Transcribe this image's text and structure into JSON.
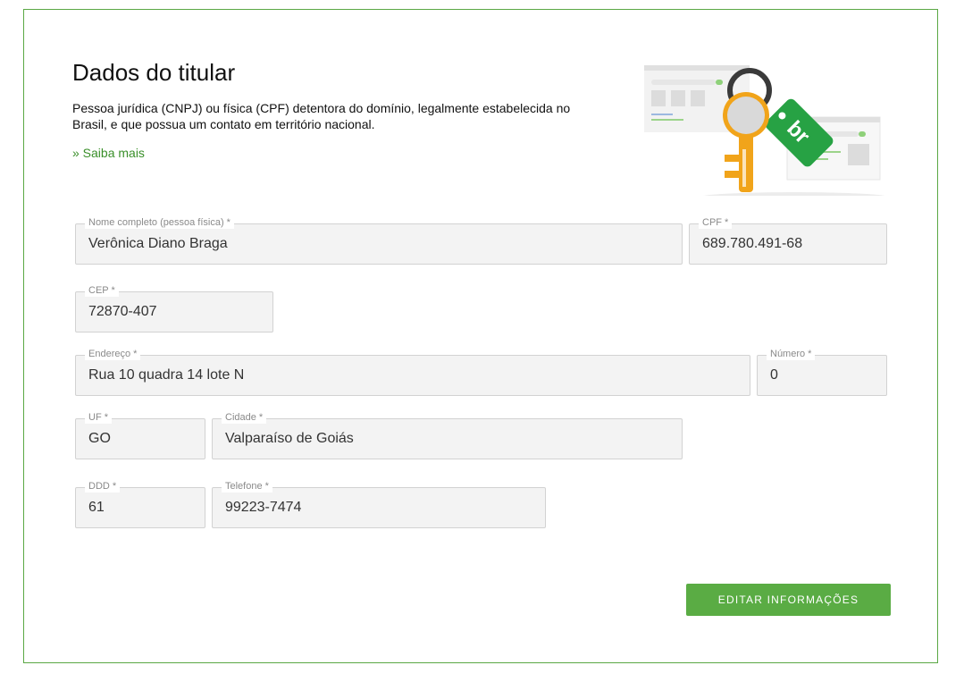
{
  "header": {
    "title": "Dados do titular",
    "description": "Pessoa jurídica (CNPJ) ou física (CPF) detentora do domínio, legalmente estabelecida no Brasil, e que possua um contato em território nacional.",
    "link": "» Saiba mais",
    "illustration_tag": "br"
  },
  "form": {
    "nome": {
      "label": "Nome completo (pessoa física) *",
      "value": "Verônica Diano Braga"
    },
    "cpf": {
      "label": "CPF *",
      "value": "689.780.491-68"
    },
    "cep": {
      "label": "CEP *",
      "value": "72870-407"
    },
    "endereco": {
      "label": "Endereço *",
      "value": "Rua 10 quadra 14 lote N"
    },
    "numero": {
      "label": "Número *",
      "value": "0"
    },
    "uf": {
      "label": "UF *",
      "value": "GO"
    },
    "cidade": {
      "label": "Cidade *",
      "value": "Valparaíso de Goiás"
    },
    "ddd": {
      "label": "DDD *",
      "value": "61"
    },
    "telefone": {
      "label": "Telefone *",
      "value": "99223-7474"
    }
  },
  "actions": {
    "edit_label": "EDITAR INFORMAÇÕES"
  },
  "colors": {
    "accent": "#5aac44",
    "link": "#3a8f2a",
    "border": "#5aa844",
    "field_bg": "#f3f3f3"
  }
}
